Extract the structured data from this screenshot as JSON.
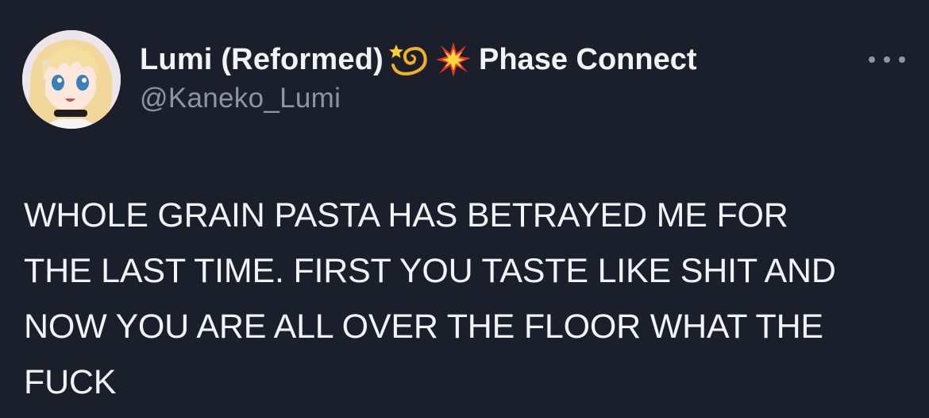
{
  "tweet": {
    "author": {
      "display_name": "Lumi (Reformed)",
      "badge_icon": "dizzy-emoji",
      "affiliation_icon": "collision-emoji",
      "affiliation": "Phase Connect",
      "handle": "@Kaneko_Lumi",
      "avatar": "anime-girl-avatar"
    },
    "menu_icon": "more-options-icon",
    "text_lines": [
      "WHOLE GRAIN PASTA HAS BETRAYED ME FOR",
      "THE LAST TIME. FIRST YOU TASTE LIKE SHIT AND",
      "NOW YOU ARE ALL OVER THE FLOOR WHAT THE",
      "FUCK"
    ]
  },
  "colors": {
    "background": "#1a1f2b",
    "primary_text": "#f2f3f5",
    "secondary_text": "#8b96a3"
  }
}
